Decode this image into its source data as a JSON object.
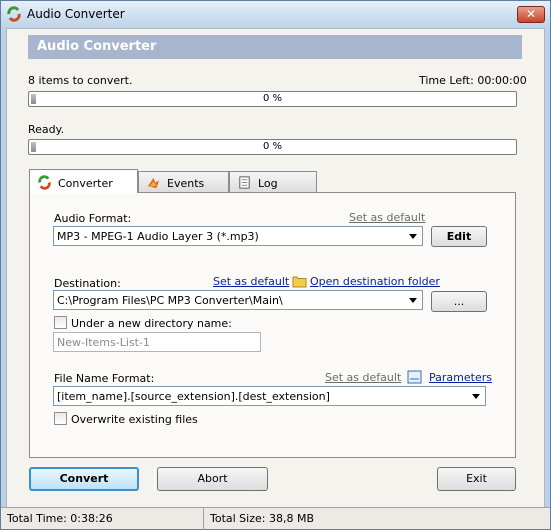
{
  "window": {
    "title": "Audio Converter",
    "close_glyph": "✕"
  },
  "banner": {
    "title": "Audio Converter"
  },
  "progress1": {
    "status": "8 items to convert.",
    "time_left": "Time Left: 00:00:00",
    "percent_text": "0 %",
    "value": 0
  },
  "progress2": {
    "status": "Ready.",
    "percent_text": "0 %",
    "value": 0
  },
  "tabs": [
    {
      "label": "Converter",
      "icon": "converter-icon"
    },
    {
      "label": "Events",
      "icon": "events-icon"
    },
    {
      "label": "Log",
      "icon": "log-icon"
    }
  ],
  "converter": {
    "audio_format_label": "Audio Format:",
    "audio_format_default": "Set as default",
    "audio_format_value": "MP3 - MPEG-1 Audio Layer 3 (*.mp3)",
    "edit_button": "Edit",
    "destination_label": "Destination:",
    "destination_default": "Set as default",
    "open_folder": "Open destination folder",
    "destination_value": "C:\\Program Files\\PC MP3 Converter\\Main\\",
    "browse_button": "...",
    "new_dir_label": "Under a new directory name:",
    "new_dir_value": "New-Items-List-1",
    "file_name_label": "File Name Format:",
    "file_name_default": "Set as default",
    "parameters": "Parameters",
    "file_name_value": "[item_name].[source_extension].[dest_extension]",
    "overwrite_label": "Overwrite existing files"
  },
  "buttons": {
    "convert": "Convert",
    "abort": "Abort",
    "exit": "Exit"
  },
  "status": {
    "total_time": "Total Time: 0:38:26",
    "total_size": "Total Size: 38,8 MB"
  }
}
